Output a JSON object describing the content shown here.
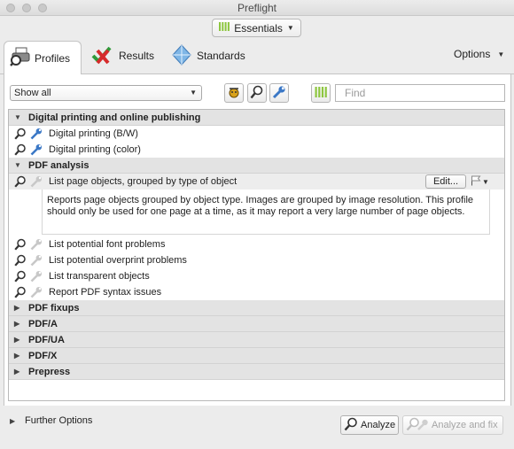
{
  "window": {
    "title": "Preflight"
  },
  "toolbar": {
    "essentials_label": "Essentials"
  },
  "tabs": {
    "profiles": "Profiles",
    "results": "Results",
    "standards": "Standards",
    "options": "Options"
  },
  "filter": {
    "selected": "Show all"
  },
  "search": {
    "placeholder": "Find"
  },
  "groups": {
    "digital": "Digital printing and online publishing",
    "pdf_analysis": "PDF analysis",
    "pdf_fixups": "PDF fixups",
    "pdfa": "PDF/A",
    "pdfua": "PDF/UA",
    "pdfx": "PDF/X",
    "prepress": "Prepress"
  },
  "profiles": {
    "digital_bw": "Digital printing (B/W)",
    "digital_color": "Digital printing (color)",
    "list_page_objects": "List page objects, grouped by type of object",
    "font_problems": "List potential font problems",
    "overprint_problems": "List potential overprint problems",
    "transparent_objects": "List transparent objects",
    "syntax_issues": "Report PDF syntax issues"
  },
  "selected_profile": {
    "edit_label": "Edit...",
    "description": "Reports page objects grouped by object type. Images are grouped by image resolution. This profile should only be used for one page at a time, as it may report a very large number of page objects."
  },
  "footer": {
    "further_options": "Further Options",
    "analyze": "Analyze",
    "analyze_and_fix": "Analyze and fix"
  },
  "colors": {
    "accent_green": "#8dc63f",
    "wrench_blue": "#3b78c6",
    "header_gray": "#e3e3e3"
  }
}
